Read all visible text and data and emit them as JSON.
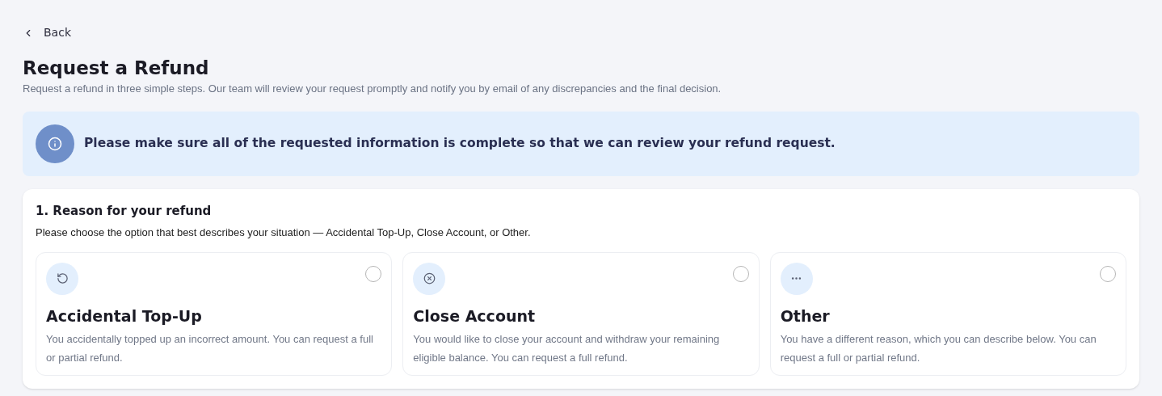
{
  "back": {
    "label": "Back"
  },
  "title": "Request a Refund",
  "subtitle": "Request a refund in three simple steps. Our team will review your request promptly and notify you by email of any discrepancies and the final decision.",
  "notice": {
    "text": "Please make sure all of the requested information is complete so that we can review your refund request."
  },
  "section": {
    "title": "1. Reason for your refund",
    "description": "Please choose the option that best describes your situation — Accidental Top-Up, Close Account, or Other.",
    "options": [
      {
        "kind": "undo",
        "title": "Accidental Top-Up",
        "description": "You accidentally topped up an incorrect amount. You can request a full or partial refund.",
        "selected": false
      },
      {
        "kind": "close",
        "title": "Close Account",
        "description": "You would like to close your account and withdraw your remaining eligible balance. You can request a full refund.",
        "selected": false
      },
      {
        "kind": "more",
        "title": "Other",
        "description": "You have a different reason, which you can describe below. You can request a full or partial refund.",
        "selected": false
      }
    ]
  }
}
